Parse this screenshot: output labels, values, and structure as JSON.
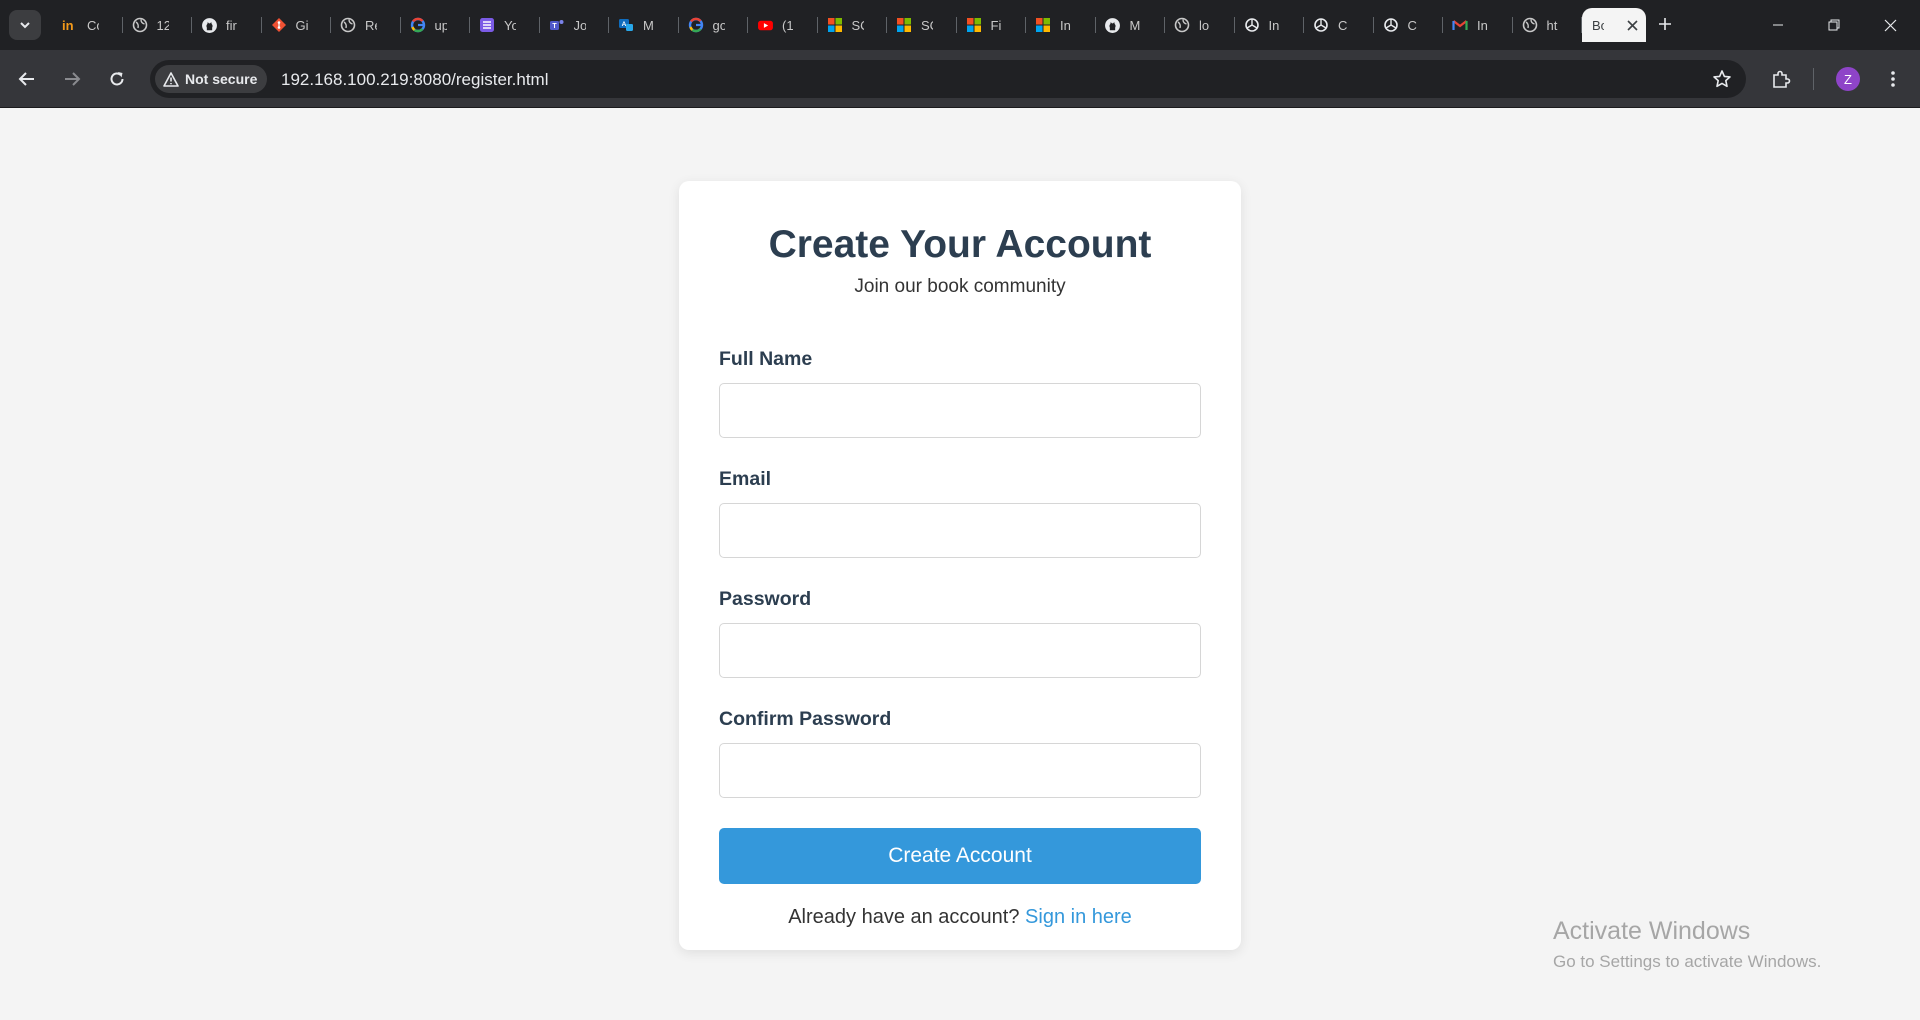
{
  "browser": {
    "tabs": [
      {
        "title": "Co",
        "icon": "in-logo-icon"
      },
      {
        "title": "12",
        "icon": "globe-icon"
      },
      {
        "title": "fir",
        "icon": "github-icon"
      },
      {
        "title": "Gi",
        "icon": "git-icon"
      },
      {
        "title": "Re",
        "icon": "globe-icon"
      },
      {
        "title": "up",
        "icon": "google-icon"
      },
      {
        "title": "Yo",
        "icon": "list-app-icon"
      },
      {
        "title": "Jo",
        "icon": "teams-icon"
      },
      {
        "title": "M",
        "icon": "translator-icon"
      },
      {
        "title": "go",
        "icon": "google-icon"
      },
      {
        "title": "(1",
        "icon": "youtube-icon"
      },
      {
        "title": "SC",
        "icon": "microsoft-icon"
      },
      {
        "title": "SC",
        "icon": "microsoft-icon"
      },
      {
        "title": "Fi",
        "icon": "microsoft-icon"
      },
      {
        "title": "In",
        "icon": "microsoft-icon"
      },
      {
        "title": "M",
        "icon": "github-icon"
      },
      {
        "title": "lo",
        "icon": "globe-icon"
      },
      {
        "title": "In",
        "icon": "openai-icon"
      },
      {
        "title": "C",
        "icon": "openai-icon"
      },
      {
        "title": "C",
        "icon": "openai-icon"
      },
      {
        "title": "In",
        "icon": "gmail-icon"
      },
      {
        "title": "ht",
        "icon": "globe-icon"
      }
    ],
    "active_tab": {
      "title": "Bo"
    },
    "security_label": "Not secure",
    "url": "192.168.100.219:8080/register.html",
    "profile_initial": "Z"
  },
  "page": {
    "title": "Create Your Account",
    "subtitle": "Join our book community",
    "fields": [
      {
        "label": "Full Name",
        "value": ""
      },
      {
        "label": "Email",
        "value": ""
      },
      {
        "label": "Password",
        "value": ""
      },
      {
        "label": "Confirm Password",
        "value": ""
      }
    ],
    "submit_label": "Create Account",
    "signin_prompt": "Already have an account?",
    "signin_link": "Sign in here"
  },
  "watermark": {
    "title": "Activate Windows",
    "subtitle": "Go to Settings to activate Windows."
  },
  "colors": {
    "accent": "#3498db",
    "heading": "#2c3e50",
    "page_bg": "#f4f4f4"
  }
}
